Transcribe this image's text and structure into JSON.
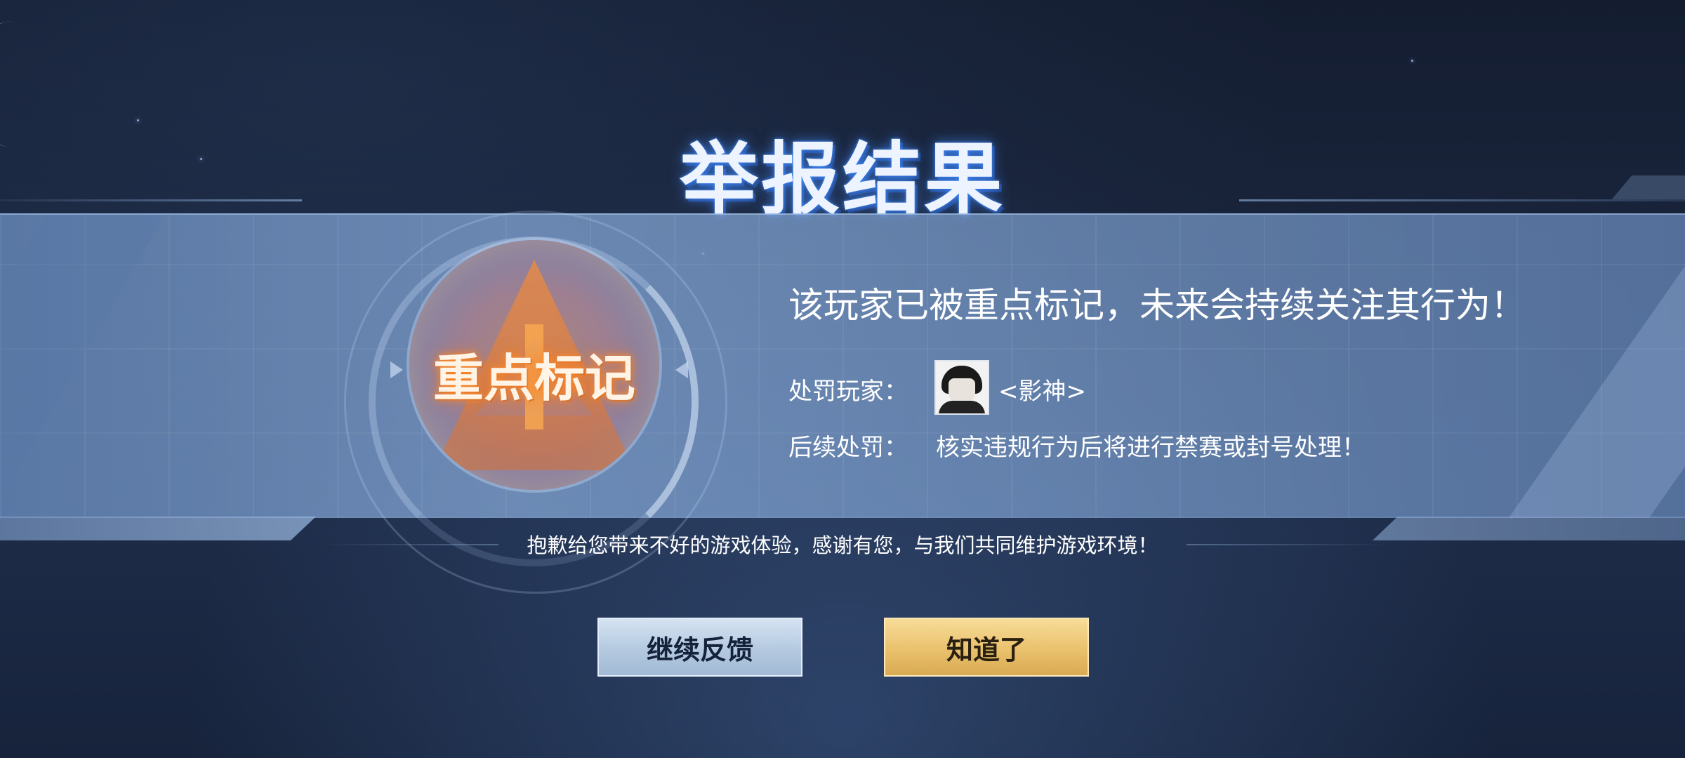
{
  "page": {
    "title": "举报结果"
  },
  "medal": {
    "status_text": "重点标记",
    "icon": "warning-triangle-icon"
  },
  "result": {
    "headline": "该玩家已被重点标记，未来会持续关注其行为！",
    "punished_player_label": "处罚玩家：",
    "punished_player_name": "<影神>",
    "followup_label": "后续处罚：",
    "followup_value": "核实违规行为后将进行禁赛或封号处理！"
  },
  "apology": "抱歉给您带来不好的游戏体验，感谢有您，与我们共同维护游戏环境！",
  "buttons": {
    "continue_feedback": "继续反馈",
    "acknowledge": "知道了"
  },
  "colors": {
    "primary_button": "#eac16c",
    "secondary_button": "#b4c9e0",
    "medal_glow": "#ff8c28",
    "title_glow": "#3f8cff"
  }
}
